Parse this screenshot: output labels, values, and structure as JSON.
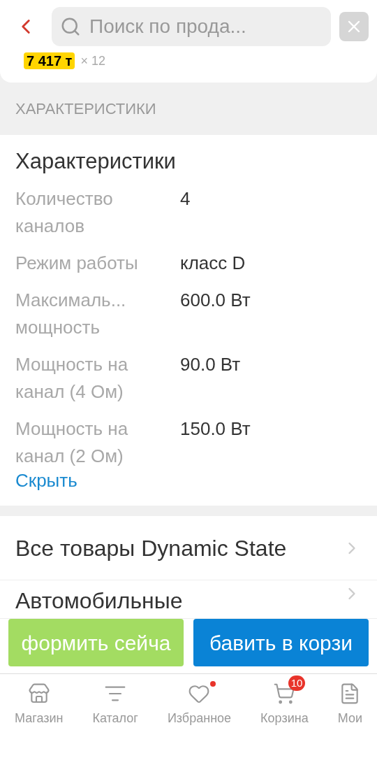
{
  "search": {
    "placeholder": "Поиск по прода..."
  },
  "price": {
    "value": "7 417 т",
    "quantity": "× 12"
  },
  "section_header": "ХАРАКТЕРИСТИКИ",
  "specs": {
    "title": "Характеристики",
    "toggle": "Скрыть",
    "rows": [
      {
        "label": "Количество каналов",
        "value": "4"
      },
      {
        "label": "Режим работы",
        "value": "класс D"
      },
      {
        "label": "Максималь... мощность",
        "value": "600.0 Вт"
      },
      {
        "label": "Мощность на канал (4 Ом)",
        "value": "90.0 Вт"
      },
      {
        "label": "Мощность на канал (2 Ом)",
        "value": "150.0 Вт"
      }
    ]
  },
  "links": [
    "Все товары Dynamic State",
    "Автомобильные"
  ],
  "actions": [
    {
      "label": "формить сейча",
      "kind": "buy"
    },
    {
      "label": "бавить в корзи",
      "kind": "cart"
    }
  ],
  "nav": [
    {
      "label": "Магазин",
      "kind": "store",
      "dot": false
    },
    {
      "label": "Каталог",
      "kind": "catalog",
      "dot": false
    },
    {
      "label": "Избранное",
      "kind": "favorites",
      "dot": true
    },
    {
      "label": "Корзина",
      "kind": "cart",
      "dot": false,
      "badge": "10"
    },
    {
      "label": "Мои",
      "kind": "orders",
      "dot": false
    }
  ]
}
